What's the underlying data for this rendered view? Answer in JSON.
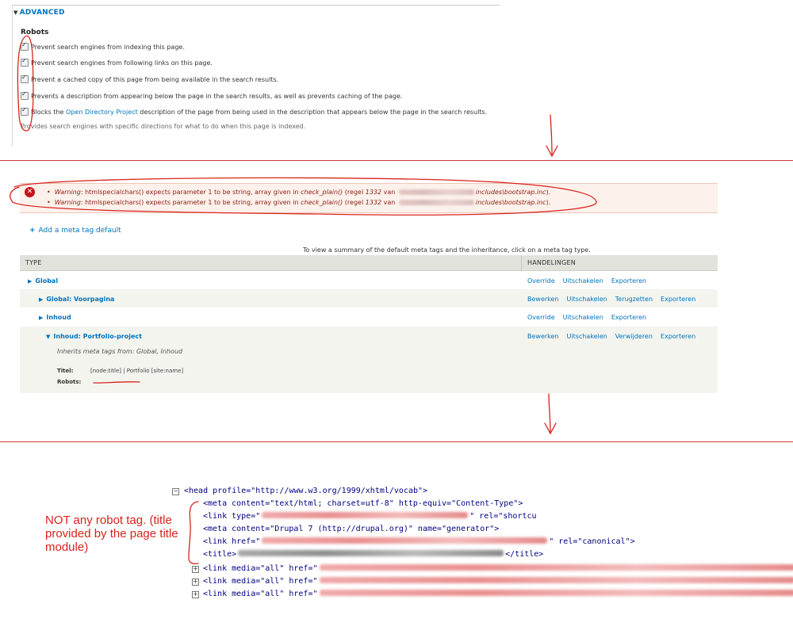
{
  "advanced": {
    "legend": "ADVANCED",
    "robots_label": "Robots",
    "options": [
      {
        "text": "Prevent search engines from indexing this page.",
        "checked": true
      },
      {
        "text": "Prevent search engines from following links on this page.",
        "checked": true
      },
      {
        "text": "Prevent a cached copy of this page from being available in the search results.",
        "checked": true
      },
      {
        "text": "Prevents a description from appearing below the page in the search results, as well as prevents caching of the page.",
        "checked": true
      }
    ],
    "odp_option": {
      "before": "Blocks the ",
      "link": "Open Directory Project",
      "after": " description of the page from being used in the description that appears below the page in the search results.",
      "checked": true
    },
    "description": "Provides search engines with specific directions for what to do when this page is indexed."
  },
  "errors": {
    "icon": "error-x-icon",
    "messages": [
      {
        "label": "Warning",
        "text1": ": htmlspecialchars() expects parameter 1 to be string, array given in ",
        "func": "check_plain()",
        "text2": " (regel ",
        "line": "1332",
        "text3": " van ",
        "path": "includes\\bootstrap.inc",
        "end": ")."
      },
      {
        "label": "Warning",
        "text1": ": htmlspecialchars() expects parameter 1 to be string, array given in ",
        "func": "check_plain()",
        "text2": " (regel ",
        "line": "1332",
        "text3": " van ",
        "path": "includes\\bootstrap.inc",
        "end": ")."
      }
    ]
  },
  "metatag": {
    "add_default": "Add a meta tag default",
    "summary_note": "To view a summary of the default meta tags and the inheritance, click on a meta tag type.",
    "columns": {
      "type": "TYPE",
      "ops": "HANDELINGEN"
    },
    "rows": [
      {
        "name": "Global",
        "ops": [
          "Override",
          "Uitschakelen",
          "Exporteren"
        ]
      },
      {
        "name": "Global: Voorpagina",
        "ops": [
          "Bewerken",
          "Uitschakelen",
          "Terugzetten",
          "Exporteren"
        ]
      },
      {
        "name": "Inhoud",
        "ops": [
          "Override",
          "Uitschakelen",
          "Exporteren"
        ]
      },
      {
        "name": "Inhoud: Portfolio-project",
        "ops": [
          "Bewerken",
          "Uitschakelen",
          "Verwijderen",
          "Exporteren"
        ]
      }
    ],
    "expanded": {
      "inherits": "Inherits meta tags from: Global, Inhoud",
      "titel_label": "Titel:",
      "titel_value": "[node:title] | Portfolio [site:name]",
      "robots_label": "Robots:"
    }
  },
  "source": {
    "head_open": "<head profile=\"http://www.w3.org/1999/xhtml/vocab\">",
    "meta1_a": "<meta content=\"text/html; charset=utf-8\" http-equiv=\"Content-Type\">",
    "link1_a": "<link type=\"",
    "link1_b": "\" rel=\"shortcu",
    "meta2": "<meta content=\"Drupal 7 (http://drupal.org)\" name=\"generator\">",
    "link2_a": "<link href=\"",
    "link2_b": "\" rel=\"canonical\">",
    "title_open": "<title>",
    "title_close": "</title>",
    "link_media": "<link media=\"all\" href=\""
  },
  "annotation": "NOT any robot tag. (title provided by the page title module)",
  "colors": {
    "annotation": "#d8231c",
    "link": "#0074bd",
    "error": "#c3141b"
  }
}
